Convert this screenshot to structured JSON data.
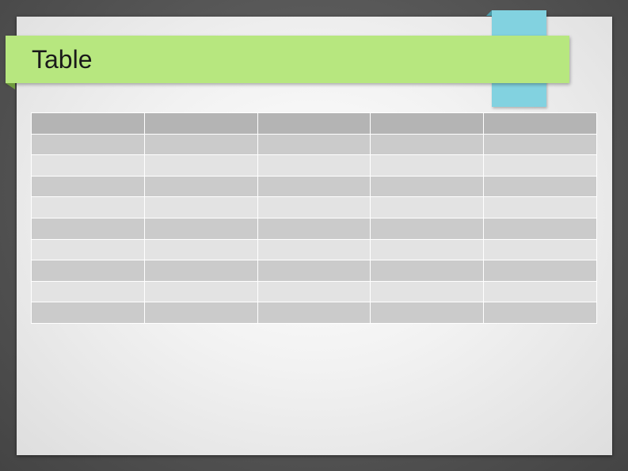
{
  "slide": {
    "title": "Table"
  },
  "table": {
    "columns": [
      "",
      "",
      "",
      "",
      ""
    ],
    "rows": [
      [
        "",
        "",
        "",
        "",
        ""
      ],
      [
        "",
        "",
        "",
        "",
        ""
      ],
      [
        "",
        "",
        "",
        "",
        ""
      ],
      [
        "",
        "",
        "",
        "",
        ""
      ],
      [
        "",
        "",
        "",
        "",
        ""
      ],
      [
        "",
        "",
        "",
        "",
        ""
      ],
      [
        "",
        "",
        "",
        "",
        ""
      ],
      [
        "",
        "",
        "",
        "",
        ""
      ],
      [
        "",
        "",
        "",
        "",
        ""
      ]
    ]
  },
  "colors": {
    "banner": "#b7e77f",
    "accent_tab": "#82d2e0",
    "header_cell": "#b4b4b4",
    "band_dark": "#cbcbcb",
    "band_light": "#e3e3e3"
  }
}
